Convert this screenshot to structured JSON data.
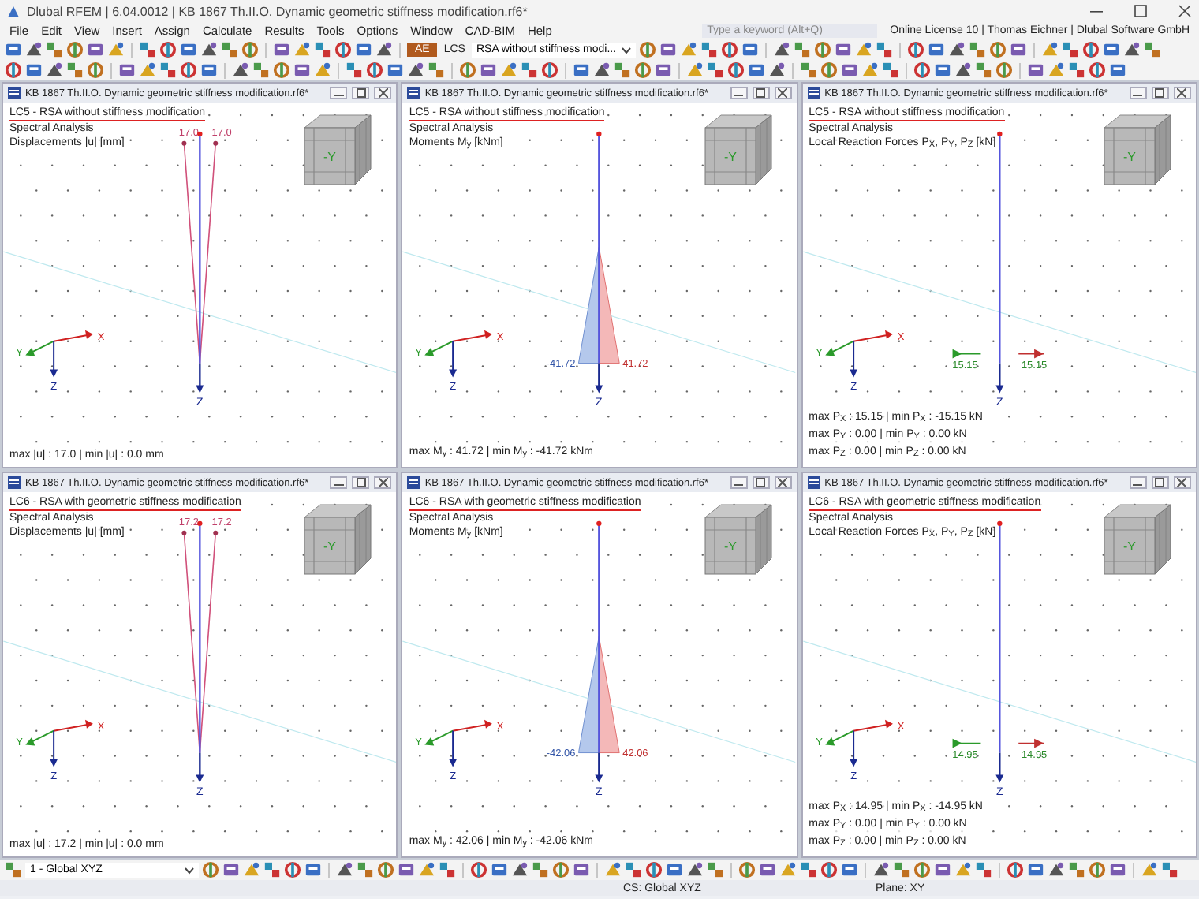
{
  "window": {
    "title": "Dlubal RFEM | 6.04.0012 | KB 1867 Th.II.O. Dynamic geometric stiffness modification.rf6*"
  },
  "menu": [
    "File",
    "Edit",
    "View",
    "Insert",
    "Assign",
    "Calculate",
    "Results",
    "Tools",
    "Options",
    "Window",
    "CAD-BIM",
    "Help"
  ],
  "search": {
    "placeholder": "Type a keyword (Alt+Q)"
  },
  "license": "Online License 10 | Thomas Eichner | Dlubal Software GmbH",
  "toolbar": {
    "badge": "AE",
    "lcs": "LCS",
    "load_case": "RSA without stiffness modi..."
  },
  "panels": [
    {
      "kind": "displacement",
      "title": "KB 1867 Th.II.O. Dynamic geometric stiffness modification.rf6*",
      "load_case": "LC5 - RSA without stiffness modification",
      "analysis": "Spectral Analysis",
      "result": "Displacements |u| [mm]",
      "cube": "-Y",
      "values": [
        "17.0",
        "17.0"
      ],
      "triad": [
        "X",
        "Y",
        "Z"
      ],
      "member_axis": "Z",
      "summary": [
        "max |u| : 17.0 | min |u| : 0.0 mm"
      ]
    },
    {
      "kind": "moment",
      "title": "KB 1867 Th.II.O. Dynamic geometric stiffness modification.rf6*",
      "load_case": "LC5 - RSA without stiffness modification",
      "analysis": "Spectral Analysis",
      "result": "Moments M$_{y}$ [kNm]",
      "cube": "-Y",
      "values": [
        "-41.72",
        "41.72"
      ],
      "triad": [
        "X",
        "Y",
        "Z"
      ],
      "member_axis": "Z",
      "summary": [
        "max M$_{y}$ : 41.72 | min M$_{y}$ : -41.72 kNm"
      ]
    },
    {
      "kind": "reaction",
      "title": "KB 1867 Th.II.O. Dynamic geometric stiffness modification.rf6*",
      "load_case": "LC5 - RSA without stiffness modification",
      "analysis": "Spectral Analysis",
      "result": "Local Reaction Forces P$_{X}$, P$_{Y}$, P$_{Z}$ [kN]",
      "cube": "-Y",
      "values": [
        "15.15",
        "15.15"
      ],
      "triad": [
        "X",
        "Y",
        "Z"
      ],
      "member_axis": "Z",
      "summary": [
        "max P$_{X}$ : 15.15 | min P$_{X}$ : -15.15 kN",
        "max P$_{Y}$ : 0.00 | min P$_{Y}$ : 0.00 kN",
        "max P$_{Z}$ : 0.00 | min P$_{Z}$ : 0.00 kN"
      ]
    },
    {
      "kind": "displacement",
      "title": "KB 1867 Th.II.O. Dynamic geometric stiffness modification.rf6*",
      "load_case": "LC6 - RSA with geometric stiffness modification",
      "analysis": "Spectral Analysis",
      "result": "Displacements |u| [mm]",
      "cube": "-Y",
      "values": [
        "17.2",
        "17.2"
      ],
      "triad": [
        "X",
        "Y",
        "Z"
      ],
      "member_axis": "Z",
      "summary": [
        "max |u| : 17.2 | min |u| : 0.0 mm"
      ]
    },
    {
      "kind": "moment",
      "title": "KB 1867 Th.II.O. Dynamic geometric stiffness modification.rf6*",
      "load_case": "LC6 - RSA with geometric stiffness modification",
      "analysis": "Spectral Analysis",
      "result": "Moments M$_{y}$ [kNm]",
      "cube": "-Y",
      "values": [
        "-42.06",
        "42.06"
      ],
      "triad": [
        "X",
        "Y",
        "Z"
      ],
      "member_axis": "Z",
      "summary": [
        "max M$_{y}$ : 42.06 | min M$_{y}$ : -42.06 kNm"
      ]
    },
    {
      "kind": "reaction",
      "title": "KB 1867 Th.II.O. Dynamic geometric stiffness modification.rf6*",
      "load_case": "LC6 - RSA with geometric stiffness modification",
      "analysis": "Spectral Analysis",
      "result": "Local Reaction Forces P$_{X}$, P$_{Y}$, P$_{Z}$ [kN]",
      "cube": "-Y",
      "values": [
        "14.95",
        "14.95"
      ],
      "triad": [
        "X",
        "Y",
        "Z"
      ],
      "member_axis": "Z",
      "summary": [
        "max P$_{X}$ : 14.95 | min P$_{X}$ : -14.95 kN",
        "max P$_{Y}$ : 0.00 | min P$_{Y}$ : 0.00 kN",
        "max P$_{Z}$ : 0.00 | min P$_{Z}$ : 0.00 kN"
      ]
    }
  ],
  "bottom_bar": {
    "coordinate_system": "1 - Global XYZ"
  },
  "status_bar": {
    "cs": "CS: Global XYZ",
    "plane": "Plane: XY"
  }
}
